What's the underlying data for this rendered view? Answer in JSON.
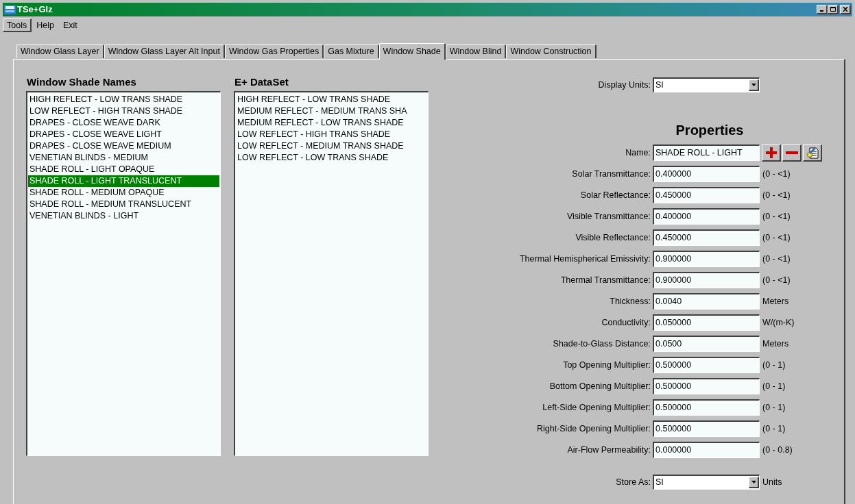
{
  "window": {
    "title": "TSe+Glz"
  },
  "menu": [
    {
      "label": "Tools",
      "selected": true
    },
    {
      "label": "Help",
      "selected": false
    },
    {
      "label": "Exit",
      "selected": false
    }
  ],
  "tabs": [
    {
      "label": "Window Glass Layer",
      "selected": false
    },
    {
      "label": "Window Glass Layer Alt Input",
      "selected": false
    },
    {
      "label": "Window Gas Properties",
      "selected": false
    },
    {
      "label": "Gas Mixture",
      "selected": false
    },
    {
      "label": "Window Shade",
      "selected": true
    },
    {
      "label": "Window Blind",
      "selected": false
    },
    {
      "label": "Window Construction",
      "selected": false
    }
  ],
  "shade_names": {
    "title": "Window Shade Names",
    "items": [
      {
        "label": "HIGH REFLECT - LOW TRANS SHADE",
        "selected": false
      },
      {
        "label": "LOW REFLECT - HIGH TRANS SHADE",
        "selected": false
      },
      {
        "label": "DRAPES - CLOSE WEAVE DARK",
        "selected": false
      },
      {
        "label": "DRAPES - CLOSE WEAVE LIGHT",
        "selected": false
      },
      {
        "label": "DRAPES - CLOSE WEAVE MEDIUM",
        "selected": false
      },
      {
        "label": "VENETIAN BLINDS - MEDIUM",
        "selected": false
      },
      {
        "label": "SHADE ROLL - LIGHT OPAQUE",
        "selected": false
      },
      {
        "label": "SHADE ROLL - LIGHT TRANSLUCENT",
        "selected": true
      },
      {
        "label": "SHADE ROLL - MEDIUM OPAQUE",
        "selected": false
      },
      {
        "label": "SHADE ROLL - MEDIUM TRANSLUCENT",
        "selected": false
      },
      {
        "label": "VENETIAN BLINDS - LIGHT",
        "selected": false
      }
    ]
  },
  "dataset": {
    "title": "E+ DataSet",
    "items": [
      {
        "label": "HIGH REFLECT - LOW TRANS SHADE",
        "selected": false
      },
      {
        "label": "MEDIUM REFLECT - MEDIUM TRANS SHA",
        "selected": false
      },
      {
        "label": "MEDIUM REFLECT - LOW TRANS SHADE",
        "selected": false
      },
      {
        "label": "LOW REFLECT - HIGH TRANS SHADE",
        "selected": false
      },
      {
        "label": "LOW REFLECT - MEDIUM TRANS SHADE",
        "selected": false
      },
      {
        "label": "LOW REFLECT - LOW TRANS SHADE",
        "selected": false
      }
    ]
  },
  "display_units": {
    "label": "Display Units:",
    "value": "SI"
  },
  "properties": {
    "title": "Properties",
    "name": {
      "label": "Name:",
      "value": "SHADE ROLL - LIGHT"
    },
    "rows": [
      {
        "label": "Solar Transmittance:",
        "value": "0.400000",
        "unit": "(0 - <1)"
      },
      {
        "label": "Solar Reflectance:",
        "value": "0.450000",
        "unit": "(0 - <1)"
      },
      {
        "label": "Visible Transmittance:",
        "value": "0.400000",
        "unit": "(0 - <1)"
      },
      {
        "label": "Visible Reflectance:",
        "value": "0.450000",
        "unit": "(0 - <1)"
      },
      {
        "label": "Thermal Hemispherical Emissivity:",
        "value": "0.900000",
        "unit": "(0 - <1)"
      },
      {
        "label": "Thermal Transmittance:",
        "value": "0.900000",
        "unit": "(0 - <1)"
      },
      {
        "label": "Thickness:",
        "value": "0.0040",
        "unit": "Meters"
      },
      {
        "label": "Conductivity:",
        "value": "0.050000",
        "unit": "W/(m-K)"
      },
      {
        "label": "Shade-to-Glass Distance:",
        "value": "0.0500",
        "unit": "Meters"
      },
      {
        "label": "Top Opening Multiplier:",
        "value": "0.500000",
        "unit": "(0 - 1)"
      },
      {
        "label": "Bottom Opening Multiplier:",
        "value": "0.500000",
        "unit": "(0 - 1)"
      },
      {
        "label": "Left-Side Opening Multiplier:",
        "value": "0.500000",
        "unit": "(0 - 1)"
      },
      {
        "label": "Right-Side Opening Multiplier:",
        "value": "0.500000",
        "unit": "(0 - 1)"
      },
      {
        "label": "Air-Flow Permeability:",
        "value": "0.000000",
        "unit": "(0 - 0.8)"
      }
    ]
  },
  "store_as": {
    "label": "Store As:",
    "value": "SI",
    "unit": "Units"
  }
}
